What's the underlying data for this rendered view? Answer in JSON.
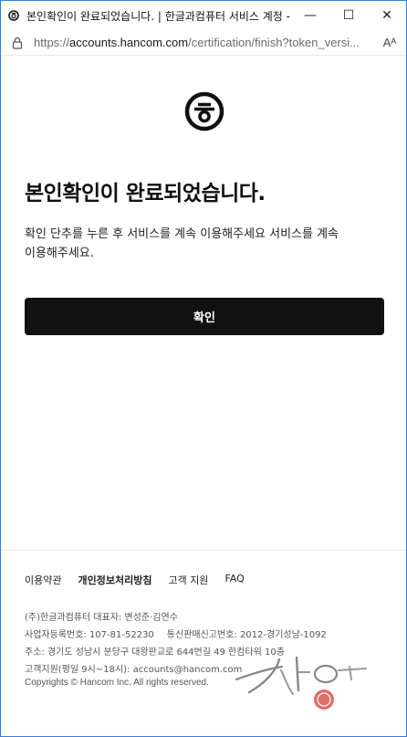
{
  "window": {
    "title": "본인확인이 완료되었습니다. | 한글과컴퓨터 서비스 계정 -...",
    "minimize_glyph": "—",
    "maximize_glyph": "☐",
    "close_glyph": "✕"
  },
  "address": {
    "scheme": "https://",
    "host": "accounts.hancom.com",
    "path": "/certification/finish?token_versi...",
    "reader_label": "Aᴬ"
  },
  "page": {
    "heading": "본인확인이 완료되었습니다.",
    "description": "확인 단추를 누른 후 서비스를 계속 이용해주세요 서비스를 계속 이용해주세요.",
    "confirm_label": "확인"
  },
  "footer": {
    "links": [
      "이용약관",
      "개인정보처리방침",
      "고객 지원",
      "FAQ"
    ],
    "company_line": "(주)한글과컴퓨터 대표자: 변성준·김연수",
    "business_no": "사업자등록번호: 107-81-52230",
    "mail_order_no": "통신판매신고번호: 2012-경기성남-1092",
    "address": "주소: 경기도 성남시 분당구 대왕판교로 644번길 49 한컴타워 10층",
    "support": "고객지원(평일 9시~18시): accounts@hancom.com",
    "copyright": "Copyrights © Hancom Inc. All rights reserved."
  },
  "icons": {
    "favicon": "hancom-logo-icon",
    "lock": "lock-icon",
    "brand_logo": "hancom-logo-icon"
  },
  "colors": {
    "button_bg": "#111111",
    "window_border": "#3a7bd5",
    "stamp_red": "#d9534f"
  }
}
